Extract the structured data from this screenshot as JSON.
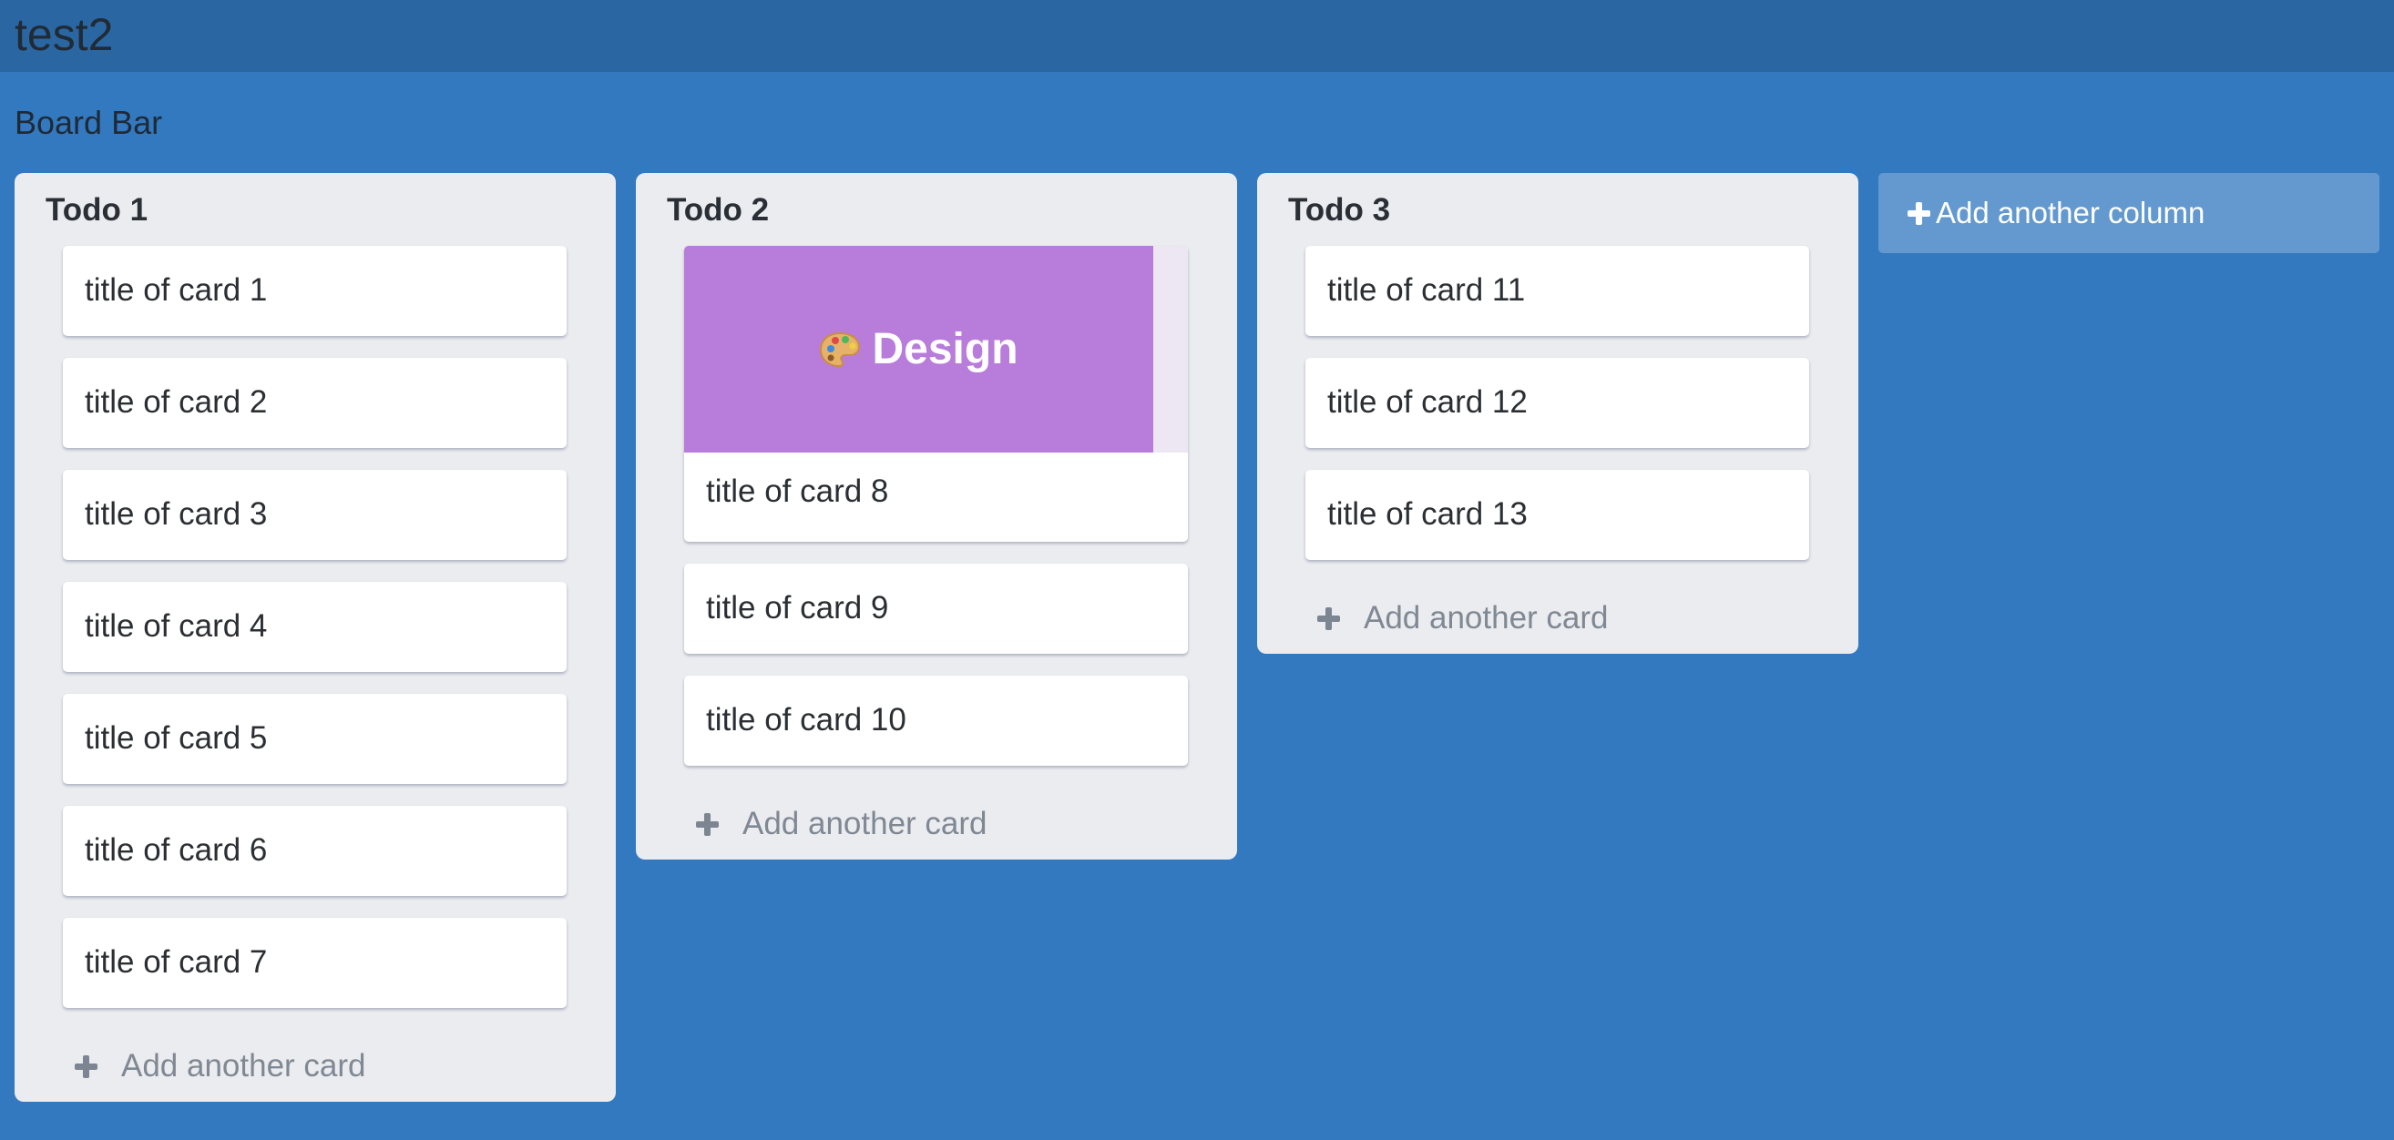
{
  "app": {
    "title": "test2"
  },
  "board_bar": {
    "label": "Board Bar"
  },
  "columns": [
    {
      "title": "Todo 1",
      "cards": [
        {
          "title": "title of card 1"
        },
        {
          "title": "title of card 2"
        },
        {
          "title": "title of card 3"
        },
        {
          "title": "title of card 4"
        },
        {
          "title": "title of card 5"
        },
        {
          "title": "title of card 6"
        },
        {
          "title": "title of card 7"
        }
      ],
      "add_card_label": "Add another card"
    },
    {
      "title": "Todo 2",
      "cards": [
        {
          "title": "title of card 8",
          "cover": {
            "label": "Design",
            "icon": "palette-icon",
            "color": "#b87cdb"
          }
        },
        {
          "title": "title of card 9"
        },
        {
          "title": "title of card 10"
        }
      ],
      "add_card_label": "Add another card"
    },
    {
      "title": "Todo 3",
      "cards": [
        {
          "title": "title of card 11"
        },
        {
          "title": "title of card 12"
        },
        {
          "title": "title of card 13"
        }
      ],
      "add_card_label": "Add another card"
    }
  ],
  "add_column": {
    "label": "Add another column",
    "icon": "plus-icon"
  },
  "colors": {
    "background": "#3379bf",
    "app_bar": "#2a67a2",
    "column": "#ebecf0",
    "card": "#ffffff",
    "cover": "#b87cdb"
  }
}
